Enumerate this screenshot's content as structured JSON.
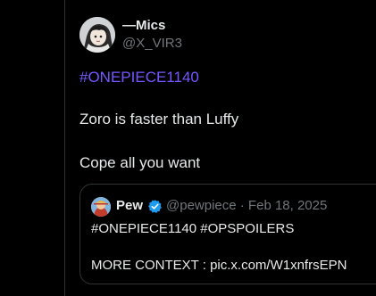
{
  "post": {
    "author": {
      "display_name": "—Mics",
      "handle": "@X_VIR3",
      "avatar_icon": "anime-character-avatar"
    },
    "hashtag": "#ONEPIECE1140",
    "line1": "Zoro is faster than Luffy",
    "line2": "Cope all you want"
  },
  "quote": {
    "author": {
      "display_name": "Pew",
      "meta": "@pewpiece · Feb 18, 2025",
      "avatar_icon": "anime-character-avatar",
      "verified_icon": "verified-badge-icon"
    },
    "text_line1": "#ONEPIECE1140 #OPSPOILERS",
    "text_line2": "MORE CONTEXT : pic.x.com/W1xnfrsEPN"
  },
  "colors": {
    "background": "#000000",
    "text": "#e7e9ea",
    "muted": "#71767b",
    "hashtag": "#7856ff",
    "verified": "#1d9bf0",
    "border": "#2f3336"
  }
}
